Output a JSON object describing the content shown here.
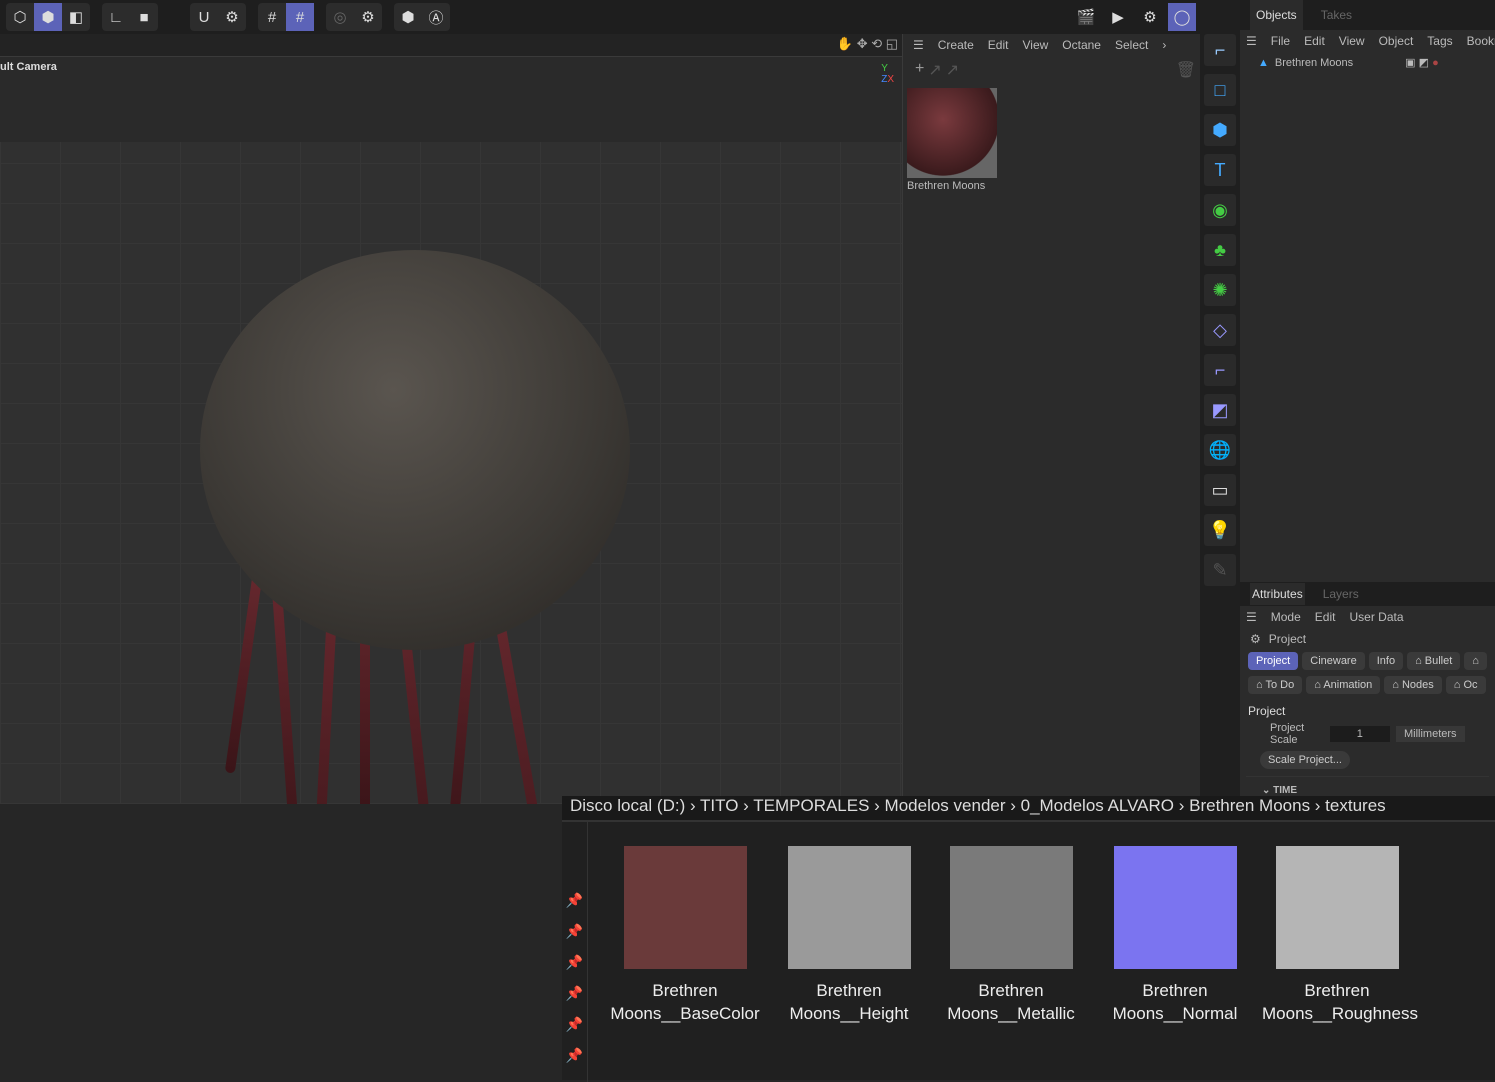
{
  "toolbar": {
    "icons": [
      "cube-outline-icon",
      "cube-solid-icon",
      "cube-multi-icon",
      "axis-icon",
      "square-icon",
      "magnet-icon",
      "gear-snap-icon",
      "grid-icon",
      "grid-lock-icon",
      "target-icon",
      "settings-icon",
      "eye-icon",
      "a-icon"
    ]
  },
  "viewport": {
    "camera_label": "ult Camera"
  },
  "material": {
    "menu": [
      "Create",
      "Edit",
      "View",
      "Octane",
      "Select"
    ],
    "item_name": "Brethren Moons"
  },
  "objects": {
    "tabs": [
      "Objects",
      "Takes"
    ],
    "menu": [
      "File",
      "Edit",
      "View",
      "Object",
      "Tags",
      "Bookmarks"
    ],
    "item": "Brethren Moons"
  },
  "attributes": {
    "tabs": [
      "Attributes",
      "Layers"
    ],
    "menu": [
      "Mode",
      "Edit",
      "User Data"
    ],
    "header": "Project",
    "chips_row1": [
      "Project",
      "Cineware",
      "Info",
      "⌂ Bullet",
      "⌂"
    ],
    "chips_row2": [
      "⌂ To Do",
      "⌂ Animation",
      "⌂ Nodes",
      "⌂ Oc"
    ],
    "section": "Project",
    "scale_label": "Project Scale",
    "scale_value": "1",
    "scale_unit": "Millimeters",
    "scale_button": "Scale Project...",
    "time_section": "TIME"
  },
  "browser": {
    "breadcrumb": "Disco local (D:)  ›  TITO  ›  TEMPORALES  ›  Modelos vender  ›  0_Modelos ALVARO  ›  Brethren Moons  ›  textures",
    "files": [
      {
        "name": "Brethren Moons__BaseColor",
        "color": "#6a3a3a"
      },
      {
        "name": "Brethren Moons__Height",
        "color": "#9a9a9a"
      },
      {
        "name": "Brethren Moons__Metallic",
        "color": "#7a7a7a"
      },
      {
        "name": "Brethren Moons__Normal",
        "color": "#7b74f0"
      },
      {
        "name": "Brethren Moons__Roughness",
        "color": "#b5b5b5"
      }
    ]
  }
}
